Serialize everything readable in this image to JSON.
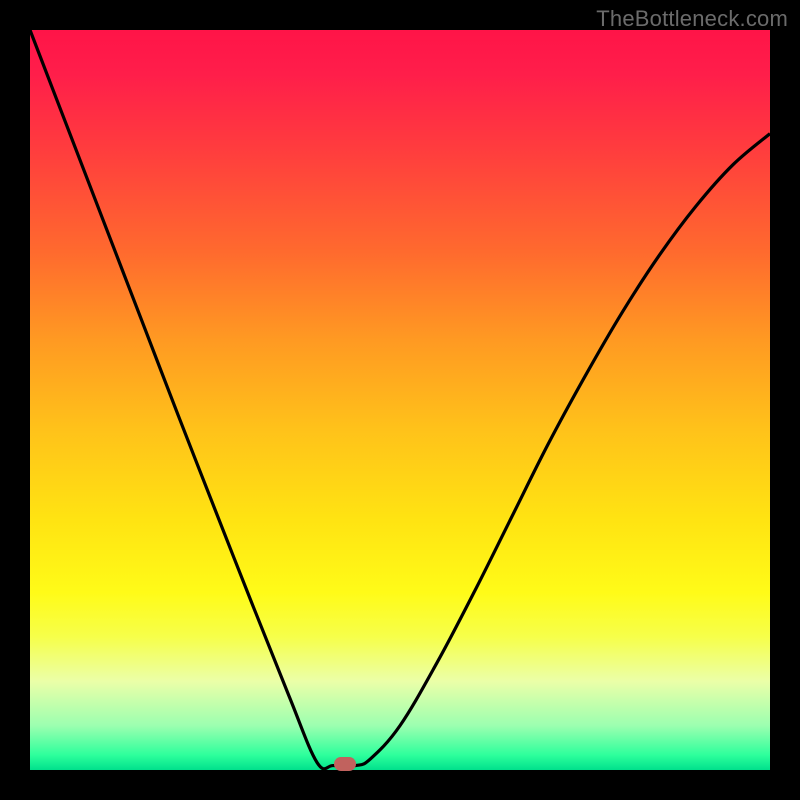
{
  "watermark": "TheBottleneck.com",
  "marker": {
    "color": "#c1625e",
    "x_frac": 0.425,
    "y_frac": 0.992
  },
  "chart_data": {
    "type": "line",
    "title": "",
    "xlabel": "",
    "ylabel": "",
    "xlim": [
      0,
      1
    ],
    "ylim": [
      0,
      1
    ],
    "grid": false,
    "series": [
      {
        "name": "curve",
        "x": [
          0.0,
          0.05,
          0.1,
          0.15,
          0.2,
          0.25,
          0.3,
          0.35,
          0.388,
          0.41,
          0.44,
          0.46,
          0.5,
          0.55,
          0.6,
          0.65,
          0.7,
          0.75,
          0.8,
          0.85,
          0.9,
          0.95,
          1.0
        ],
        "y": [
          1.0,
          0.87,
          0.74,
          0.61,
          0.48,
          0.352,
          0.225,
          0.1,
          0.01,
          0.006,
          0.006,
          0.015,
          0.06,
          0.145,
          0.24,
          0.34,
          0.44,
          0.532,
          0.618,
          0.695,
          0.762,
          0.818,
          0.86
        ]
      }
    ],
    "background_gradient": {
      "direction": "vertical",
      "stops": [
        {
          "pos": 0.0,
          "color": "#ff1448"
        },
        {
          "pos": 0.3,
          "color": "#ff6a2e"
        },
        {
          "pos": 0.55,
          "color": "#ffc21a"
        },
        {
          "pos": 0.78,
          "color": "#fffb18"
        },
        {
          "pos": 0.92,
          "color": "#c8ff9c"
        },
        {
          "pos": 1.0,
          "color": "#00e08c"
        }
      ]
    },
    "annotations": [
      {
        "type": "marker",
        "shape": "pill",
        "x": 0.425,
        "y": 0.008,
        "color": "#c1625e"
      }
    ]
  }
}
